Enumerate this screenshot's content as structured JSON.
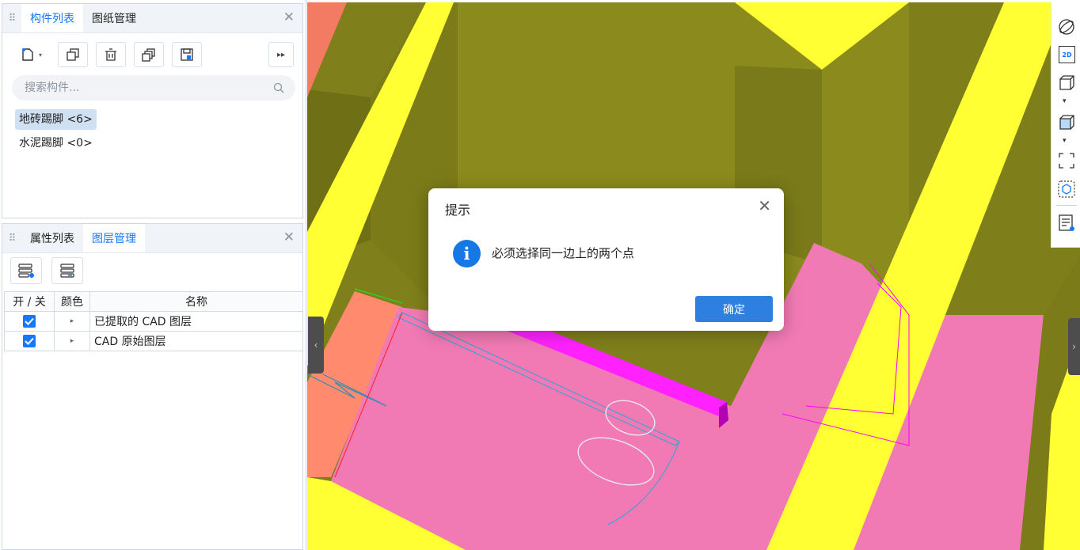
{
  "component_panel": {
    "tabs": [
      "构件列表",
      "图纸管理"
    ],
    "search_placeholder": "搜索构件...",
    "items": [
      "地砖踢脚 <6>",
      "水泥踢脚 <0>"
    ]
  },
  "layer_panel": {
    "tabs": [
      "属性列表",
      "图层管理"
    ],
    "columns": [
      "开 / 关",
      "颜色",
      "名称"
    ],
    "rows": [
      {
        "name": "已提取的 CAD 图层",
        "on": true
      },
      {
        "name": "CAD 原始图层",
        "on": true
      }
    ]
  },
  "right_toolbar": {
    "label_2d": "2D"
  },
  "dialog": {
    "title": "提示",
    "message": "必须选择同一边上的两个点",
    "ok_label": "确定"
  },
  "colors": {
    "accent": "#1677ff",
    "yellow": "#ffff33",
    "olive": "#8a8a1f",
    "pink": "#f07ab3",
    "salmon": "#ff8a6e",
    "magenta": "#ff00ff"
  }
}
